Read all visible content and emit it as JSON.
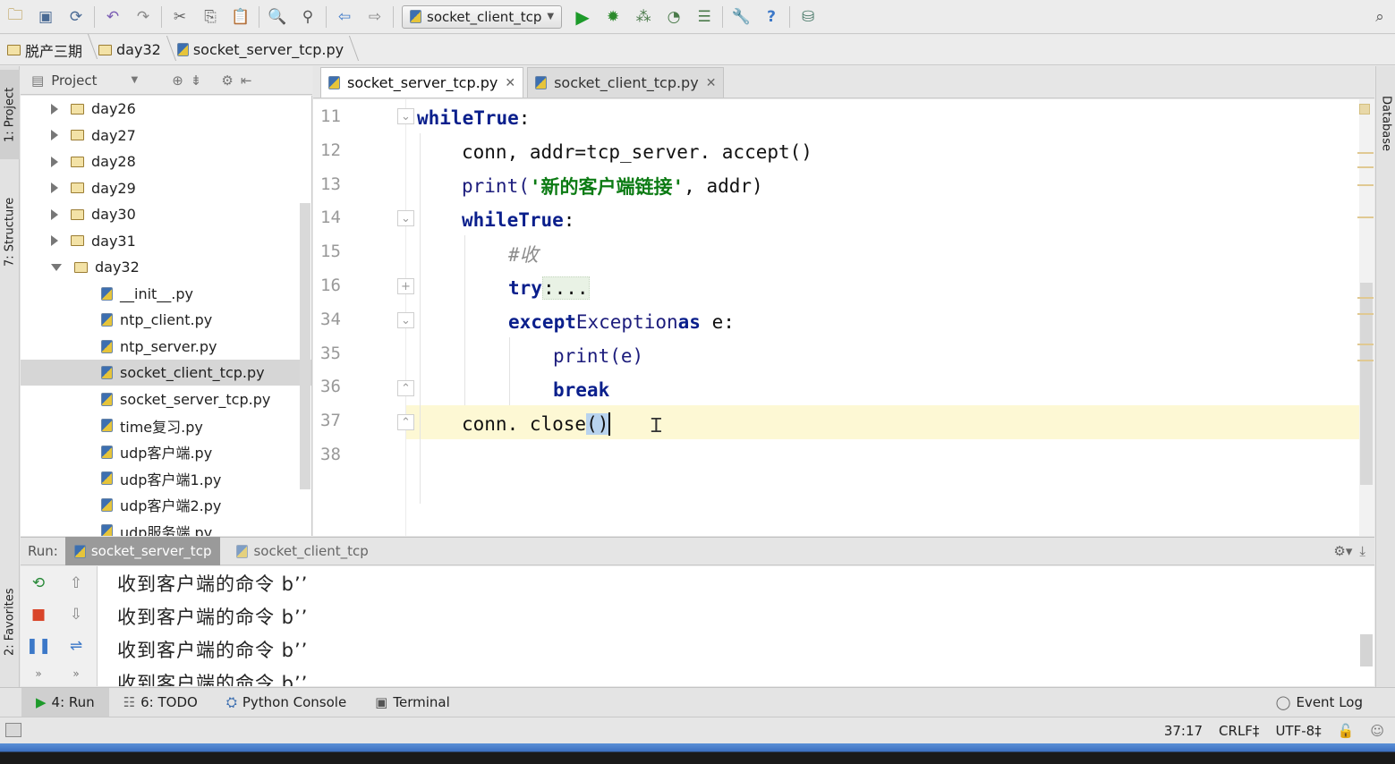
{
  "toolbar": {
    "run_config": "socket_client_tcp",
    "icons": [
      "open-icon",
      "save-icon",
      "sync-icon",
      "undo-icon",
      "redo-icon",
      "cut-icon",
      "copy-icon",
      "paste-icon",
      "find-icon",
      "replace-icon",
      "back-icon",
      "forward-icon",
      "run-icon",
      "debug-icon",
      "coverage-icon",
      "profile-icon",
      "concurrency-icon",
      "settings-icon",
      "help-icon",
      "sdk-icon",
      "search-icon"
    ]
  },
  "breadcrumb": [
    "脱产三期",
    "day32",
    "socket_server_tcp.py"
  ],
  "left_strip": {
    "project": "1: Project",
    "structure": "7: Structure",
    "favorites": "2: Favorites"
  },
  "right_strip": {
    "database": "Database"
  },
  "project_panel": {
    "title": "Project",
    "tree": [
      {
        "label": "day26",
        "type": "folder",
        "expanded": false
      },
      {
        "label": "day27",
        "type": "folder",
        "expanded": false
      },
      {
        "label": "day28",
        "type": "folder",
        "expanded": false
      },
      {
        "label": "day29",
        "type": "folder",
        "expanded": false
      },
      {
        "label": "day30",
        "type": "folder",
        "expanded": false
      },
      {
        "label": "day31",
        "type": "folder",
        "expanded": false
      },
      {
        "label": "day32",
        "type": "folder",
        "expanded": true
      },
      {
        "label": "__init__.py",
        "type": "file"
      },
      {
        "label": "ntp_client.py",
        "type": "file"
      },
      {
        "label": "ntp_server.py",
        "type": "file"
      },
      {
        "label": "socket_client_tcp.py",
        "type": "file",
        "selected": true
      },
      {
        "label": "socket_server_tcp.py",
        "type": "file"
      },
      {
        "label": "time复习.py",
        "type": "file"
      },
      {
        "label": "udp客户端.py",
        "type": "file"
      },
      {
        "label": "udp客户端1.py",
        "type": "file"
      },
      {
        "label": "udp客户端2.py",
        "type": "file"
      },
      {
        "label": "udp服务端.py",
        "type": "file"
      }
    ]
  },
  "editor": {
    "tabs": [
      {
        "label": "socket_server_tcp.py",
        "active": true
      },
      {
        "label": "socket_client_tcp.py",
        "active": false
      }
    ],
    "lines": [
      {
        "num": "11"
      },
      {
        "num": "12"
      },
      {
        "num": "13"
      },
      {
        "num": "14"
      },
      {
        "num": "15"
      },
      {
        "num": "16"
      },
      {
        "num": "34"
      },
      {
        "num": "35"
      },
      {
        "num": "36"
      },
      {
        "num": "37"
      },
      {
        "num": "38"
      }
    ],
    "code": {
      "l11_kw": "while",
      "l11_bi": "True",
      "l11_rest": ":",
      "l12": "conn, addr=tcp_server. accept()",
      "l13_pre": "print(",
      "l13_str": "'新的客户端链接'",
      "l13_post": ", addr)",
      "l14_kw": "while",
      "l14_bi": "True",
      "l14_rest": ":",
      "l15": "#收",
      "l16_kw": "try",
      "l16_rest": ":...",
      "l34_kw": "except",
      "l34_cls": "Exception",
      "l34_as": "as",
      "l34_rest": " e:",
      "l35": "print(e)",
      "l36": "break",
      "l37_pre": "conn. close",
      "l37_paren": "()"
    }
  },
  "run_panel": {
    "label": "Run:",
    "tabs": [
      {
        "label": "socket_server_tcp",
        "active": true
      },
      {
        "label": "socket_client_tcp",
        "active": false
      }
    ],
    "output": [
      "收到客户端的命令 b’’",
      "收到客户端的命令 b’’",
      "收到客户端的命令 b’’",
      "收到客户端的命令 b’’"
    ]
  },
  "tool_windows": [
    {
      "label": "4: Run",
      "active": true
    },
    {
      "label": "6: TODO",
      "active": false
    },
    {
      "label": "Python Console",
      "active": false
    },
    {
      "label": "Terminal",
      "active": false
    }
  ],
  "event_log": "Event Log",
  "status": {
    "position": "37:17",
    "line_sep": "CRLF‡",
    "encoding": "UTF-8‡"
  }
}
